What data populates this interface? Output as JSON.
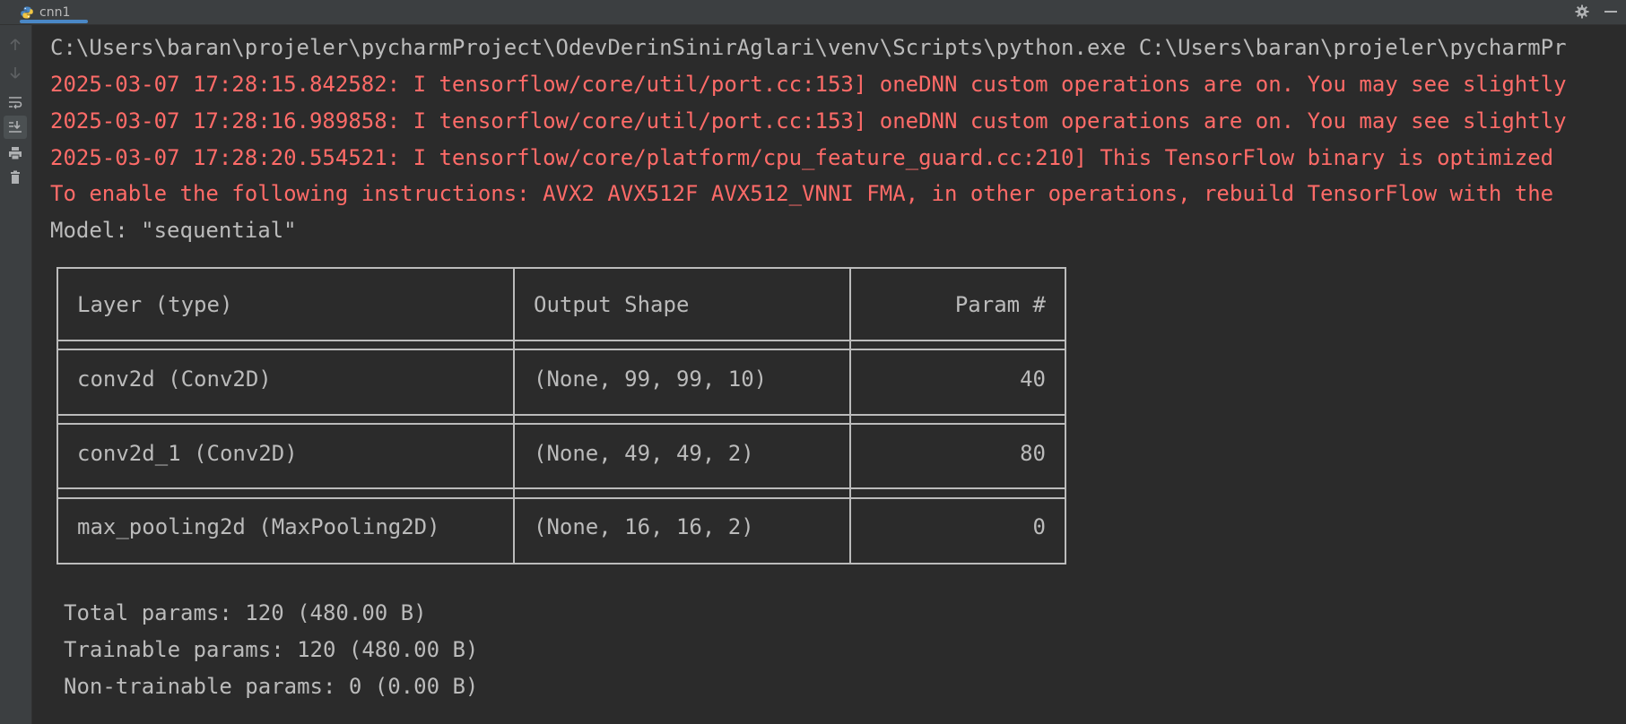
{
  "tab": {
    "title": "cnn1"
  },
  "toolbar": {
    "icons": [
      "settings-icon",
      "minimize-icon"
    ]
  },
  "sidebar": {
    "icons": [
      "up-arrow-icon",
      "down-arrow-icon",
      "soft-wrap-icon",
      "scroll-to-end-icon",
      "print-icon",
      "trash-icon"
    ]
  },
  "console": {
    "lines": [
      "C:\\Users\\baran\\projeler\\pycharmProject\\OdevDerinSinirAglari\\venv\\Scripts\\python.exe C:\\Users\\baran\\projeler\\pycharmPr",
      "2025-03-07 17:28:15.842582: I tensorflow/core/util/port.cc:153] oneDNN custom operations are on. You may see slightly",
      "2025-03-07 17:28:16.989858: I tensorflow/core/util/port.cc:153] oneDNN custom operations are on. You may see slightly",
      "2025-03-07 17:28:20.554521: I tensorflow/core/platform/cpu_feature_guard.cc:210] This TensorFlow binary is optimized",
      "To enable the following instructions: AVX2 AVX512F AVX512_VNNI FMA, in other operations, rebuild TensorFlow with the",
      "Model: \"sequential\""
    ],
    "summary_table": {
      "headers": [
        "Layer (type)",
        "Output Shape",
        "Param #"
      ],
      "rows": [
        [
          "conv2d (Conv2D)",
          "(None, 99, 99, 10)",
          "40"
        ],
        [
          "conv2d_1 (Conv2D)",
          "(None, 49, 49, 2)",
          "80"
        ],
        [
          "max_pooling2d (MaxPooling2D)",
          "(None, 16, 16, 2)",
          "0"
        ]
      ]
    },
    "totals": [
      "Total params: 120 (480.00 B)",
      "Trainable params: 120 (480.00 B)",
      "Non-trainable params: 0 (0.00 B)"
    ]
  },
  "colors": {
    "background": "#2b2b2b",
    "error_text": "#ff6b68",
    "normal_text": "#bbbbbb",
    "tab_accent": "#4a88c7"
  }
}
